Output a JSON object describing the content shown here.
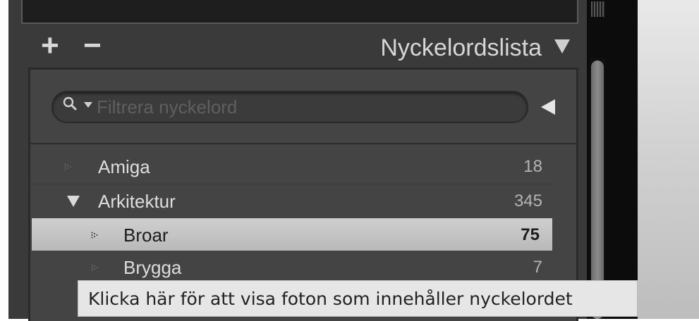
{
  "panel": {
    "add_label": "+",
    "remove_label": "−",
    "title": "Nyckelordslista"
  },
  "filter": {
    "placeholder": "Filtrera nyckelord",
    "value": ""
  },
  "keywords": [
    {
      "name": "Amiga",
      "count": "18",
      "expanded": false,
      "selected": false
    },
    {
      "name": "Arkitektur",
      "count": "345",
      "expanded": true,
      "selected": false
    },
    {
      "name": "Broar",
      "count": "75",
      "expanded": false,
      "selected": true
    },
    {
      "name": "Brygga",
      "count": "7",
      "expanded": false,
      "selected": false
    }
  ],
  "tooltip": {
    "text": "Klicka här för att visa foton som innehåller nyckelordet"
  },
  "colors": {
    "panel_bg": "#3a3a3a",
    "list_bg": "#444444",
    "selected_row": "#c4c4c4",
    "tooltip_bg": "#e6e6e6"
  },
  "icons": [
    "plus-icon",
    "minus-icon",
    "collapse-triangle-icon",
    "search-icon",
    "chevron-down-icon",
    "filter-toggle-triangle-icon",
    "row-arrow-icon",
    "expand-triangle-icon"
  ]
}
